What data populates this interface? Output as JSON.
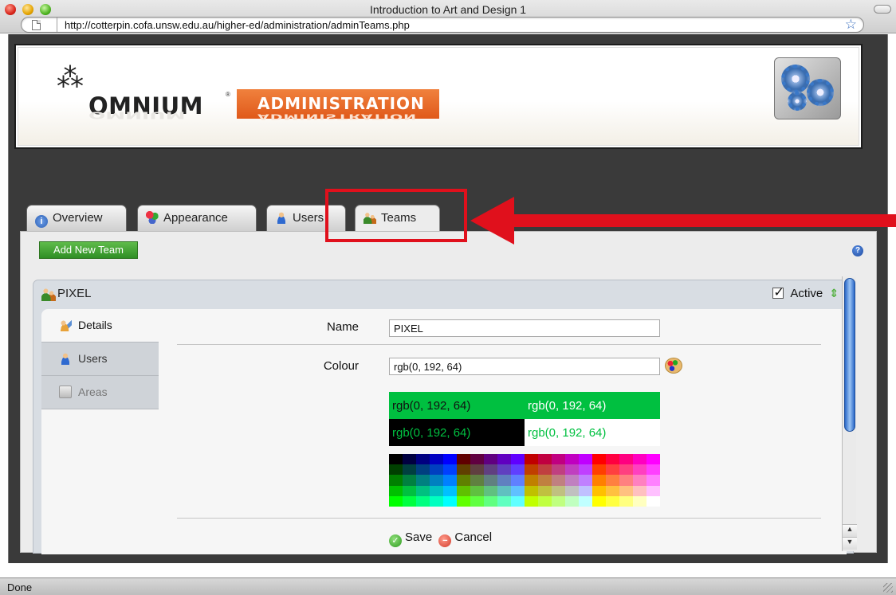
{
  "window": {
    "title": "Introduction to Art and Design 1",
    "url": "http://cotterpin.cofa.unsw.edu.au/higher-ed/administration/adminTeams.php",
    "status": "Done"
  },
  "banner": {
    "logo_text": "OMNIUM",
    "logo_mark": "®",
    "section": "ADMINISTRATION"
  },
  "tabs": [
    {
      "label": "Overview",
      "icon": "info-icon"
    },
    {
      "label": "Appearance",
      "icon": "palette-icon"
    },
    {
      "label": "Users",
      "icon": "user-icon"
    },
    {
      "label": "Teams",
      "icon": "team-icon",
      "active": true
    }
  ],
  "toolbar": {
    "add_label": "Add New Team",
    "help_glyph": "?"
  },
  "team": {
    "name": "PIXEL",
    "active_label": "Active",
    "active": true,
    "sidebar": [
      {
        "label": "Details",
        "icon": "details-icon",
        "active": true
      },
      {
        "label": "Users",
        "icon": "user-icon"
      },
      {
        "label": "Areas",
        "icon": "box-icon",
        "disabled": true
      }
    ],
    "form": {
      "name_label": "Name",
      "name_value": "PIXEL",
      "colour_label": "Colour",
      "colour_value": "rgb(0, 192, 64)",
      "samples": [
        "rgb(0, 192, 64)",
        "rgb(0, 192, 64)",
        "rgb(0, 192, 64)",
        "rgb(0, 192, 64)"
      ],
      "save_label": "Save",
      "cancel_label": "Cancel"
    }
  },
  "colors": {
    "accent_orange": "#e8651f",
    "team_colour": "#00c040",
    "annotation_red": "#e0101c",
    "button_green": "#3c9e2e"
  }
}
